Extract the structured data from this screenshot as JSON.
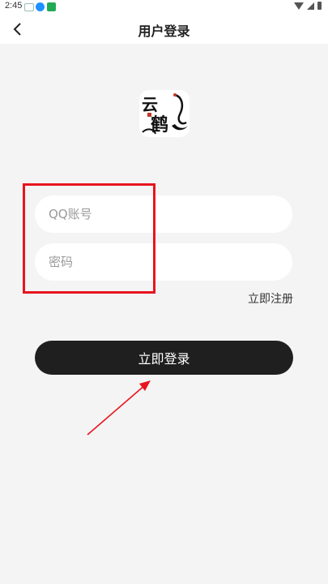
{
  "status_bar": {
    "time": "2:45",
    "icons": [
      "notification-icon",
      "app-icon",
      "app-icon-green"
    ],
    "right_icons": [
      "wifi-icon",
      "signal-icon",
      "battery-icon"
    ]
  },
  "header": {
    "title": "用户登录",
    "back_icon": "chevron-left-icon"
  },
  "logo": {
    "chars": [
      "云",
      "鹤"
    ],
    "colors": {
      "ink": "#111111",
      "stamp": "#c0392b"
    }
  },
  "form": {
    "account_placeholder": "QQ账号",
    "account_value": "",
    "password_placeholder": "密码",
    "password_value": "",
    "register_label": "立即注册",
    "login_label": "立即登录"
  },
  "annotation": {
    "highlight_color": "#e8141e"
  },
  "colors": {
    "background": "#f4f4f4",
    "header": "#ffffff",
    "button": "#1f1f1f",
    "button_text": "#ffffff"
  }
}
